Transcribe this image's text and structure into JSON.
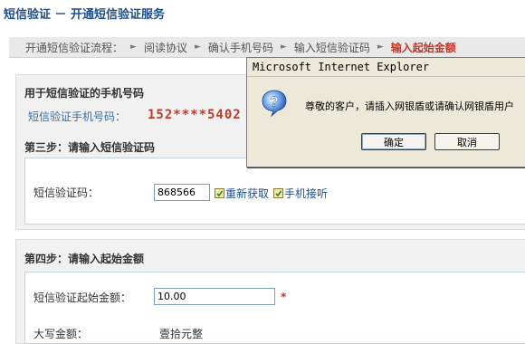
{
  "header": {
    "title": "短信验证 － 开通短信验证服务"
  },
  "breadcrumb": {
    "items": [
      {
        "label": "开通短信验证流程：",
        "active": false
      },
      {
        "label": "阅读协议",
        "active": false
      },
      {
        "label": "确认手机号码",
        "active": false
      },
      {
        "label": "输入短信验证码",
        "active": false
      },
      {
        "label": "输入起始金额",
        "active": true
      }
    ]
  },
  "phone_section": {
    "heading": "用于短信验证的手机号码",
    "label": "短信验证手机号码：",
    "value": "152****5402"
  },
  "step3": {
    "heading": "第三步：请输入短信验证码",
    "code_label": "短信验证码：",
    "code_value": "868566",
    "resend_link": "重新获取",
    "phone_receive_link": "手机接听"
  },
  "step4": {
    "heading": "第四步：请输入起始金额",
    "amount_label": "短信验证起始金额：",
    "amount_value": "10.00",
    "required_mark": "*",
    "uppercase_label": "大写金额：",
    "uppercase_value": "壹拾元整"
  },
  "dialog": {
    "title": "Microsoft Internet Explorer",
    "message": "尊敬的客户，请插入网银盾或请确认网银盾用户",
    "ok_label": "确定",
    "cancel_label": "取消",
    "icon": "question-icon"
  },
  "colors": {
    "title_blue": "#1f4e8c",
    "accent_red": "#c0392b",
    "dialog_bg": "#ece9d8"
  }
}
